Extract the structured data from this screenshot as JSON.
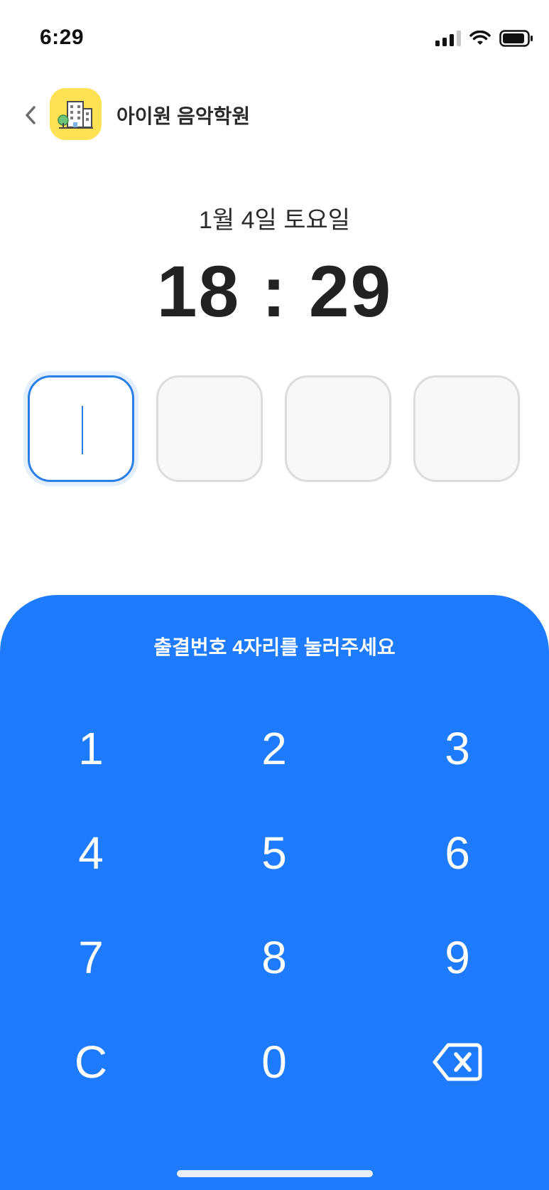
{
  "status_bar": {
    "time": "6:29",
    "icons": [
      "cellular-signal-icon",
      "wifi-icon",
      "battery-icon"
    ]
  },
  "header": {
    "back_icon": "chevron-left-icon",
    "logo_icon": "building-icon",
    "academy_name": "아이원 음악학원"
  },
  "datetime": {
    "date": "1월 4일 토요일",
    "time": "18 : 29"
  },
  "pin": {
    "length": 4,
    "entered": [
      "",
      "",
      "",
      ""
    ],
    "active_index": 0
  },
  "keypad": {
    "hint": "출결번호 4자리를 눌러주세요",
    "keys": [
      "1",
      "2",
      "3",
      "4",
      "5",
      "6",
      "7",
      "8",
      "9",
      "C",
      "0",
      "⌫"
    ]
  },
  "colors": {
    "accent": "#1e7bfd",
    "logo_bg": "#ffe253",
    "active_border": "#2a7fe8",
    "inactive_border": "#dcdcdc"
  }
}
